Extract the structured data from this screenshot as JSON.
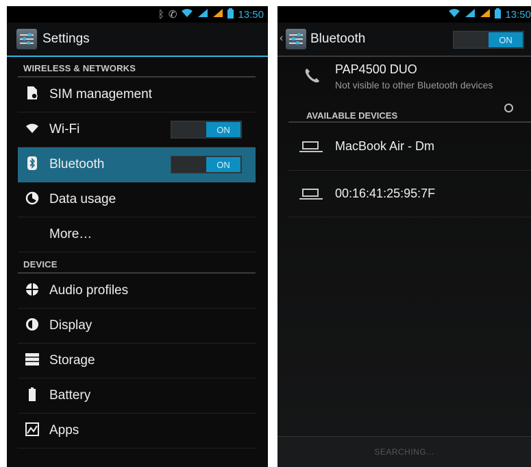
{
  "left": {
    "status": {
      "time": "13:50"
    },
    "actionbar": {
      "title": "Settings"
    },
    "sections": [
      {
        "header": "WIRELESS & NETWORKS"
      },
      {
        "header": "DEVICE"
      }
    ],
    "items": {
      "sim": {
        "label": "SIM management",
        "icon": "sim-icon"
      },
      "wifi": {
        "label": "Wi-Fi",
        "icon": "wifi-icon",
        "toggle": "ON"
      },
      "bluetooth": {
        "label": "Bluetooth",
        "icon": "bluetooth-icon",
        "toggle": "ON"
      },
      "data": {
        "label": "Data usage",
        "icon": "data-usage-icon"
      },
      "more": {
        "label": "More…"
      },
      "audio": {
        "label": "Audio profiles",
        "icon": "audio-profiles-icon"
      },
      "display": {
        "label": "Display",
        "icon": "display-icon"
      },
      "storage": {
        "label": "Storage",
        "icon": "storage-icon"
      },
      "battery": {
        "label": "Battery",
        "icon": "battery-icon"
      },
      "apps": {
        "label": "Apps",
        "icon": "apps-icon"
      }
    }
  },
  "right": {
    "status": {
      "time": "13:50"
    },
    "actionbar": {
      "title": "Bluetooth",
      "toggle": "ON"
    },
    "device": {
      "name": "PAP4500 DUO",
      "subtitle": "Not visible to other Bluetooth devices"
    },
    "available_header": "AVAILABLE DEVICES",
    "devices": [
      {
        "name": "MacBook Air - Dm"
      },
      {
        "name": "00:16:41:25:95:7F"
      }
    ],
    "bottom": "SEARCHING..."
  },
  "colors": {
    "accent": "#33b5e5",
    "selected_row": "#1e6a86",
    "toggle_on": "#0d8fc2"
  }
}
